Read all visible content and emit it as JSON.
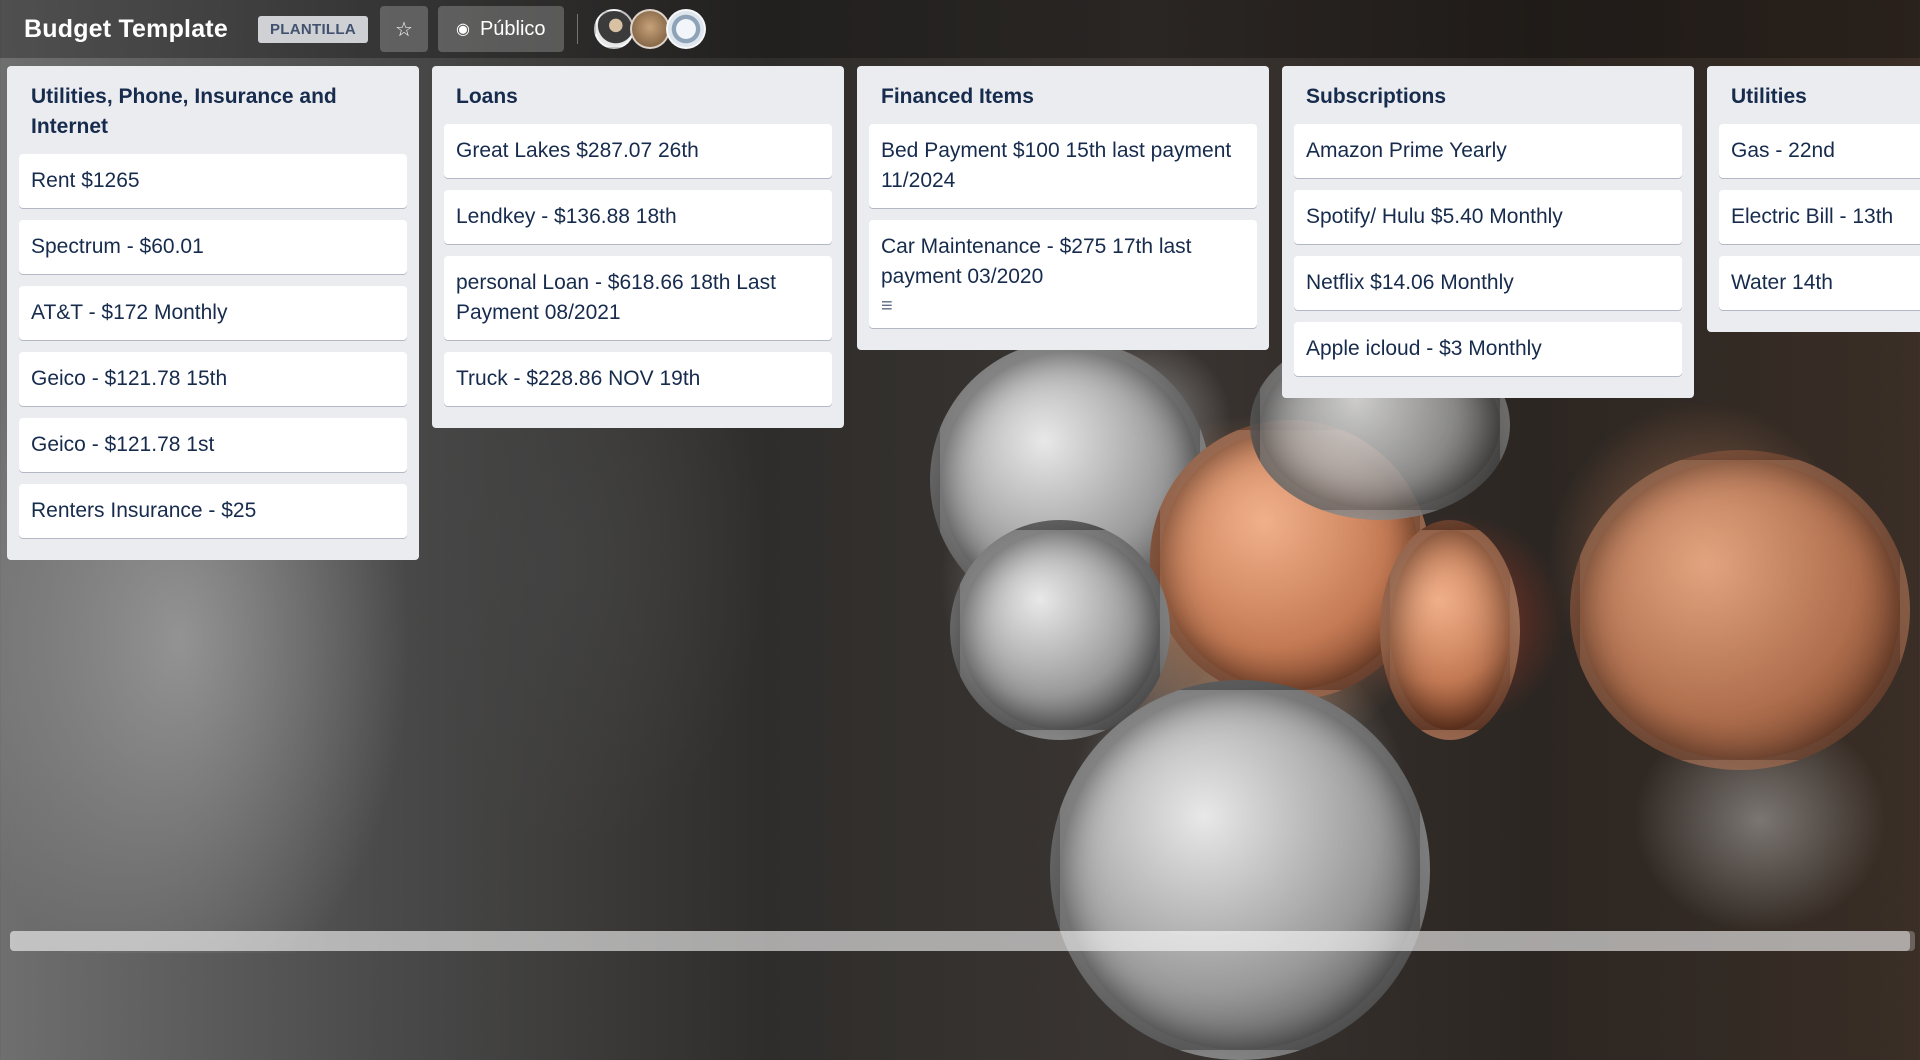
{
  "header": {
    "title": "Budget Template",
    "badge": "PLANTILLA",
    "star_icon": "☆",
    "visibility_icon": "◉",
    "visibility_label": "Público"
  },
  "lists": [
    {
      "title": "Utilities, Phone, Insurance and Internet",
      "cards": [
        "Rent $1265",
        "Spectrum - $60.01",
        "AT&T - $172 Monthly",
        "Geico - $121.78 15th",
        "Geico - $121.78 1st",
        "Renters Insurance - $25"
      ]
    },
    {
      "title": "Loans",
      "cards": [
        "Great Lakes $287.07 26th",
        "Lendkey - $136.88 18th",
        "personal Loan - $618.66 18th Last Payment 08/2021",
        "Truck - $228.86 NOV 19th"
      ]
    },
    {
      "title": "Financed Items",
      "cards": [
        "Bed Payment $100 15th last payment 11/2024",
        "Car Maintenance - $275 17th last payment 03/2020"
      ],
      "desc_icon": "≡"
    },
    {
      "title": "Subscriptions",
      "cards": [
        "Amazon Prime Yearly",
        "Spotify/ Hulu $5.40 Monthly",
        "Netflix $14.06 Monthly",
        "Apple icloud - $3 Monthly"
      ]
    },
    {
      "title": "Utilities",
      "cards": [
        "Gas - 22nd",
        "Electric Bill - 13th",
        "Water 14th"
      ]
    }
  ]
}
